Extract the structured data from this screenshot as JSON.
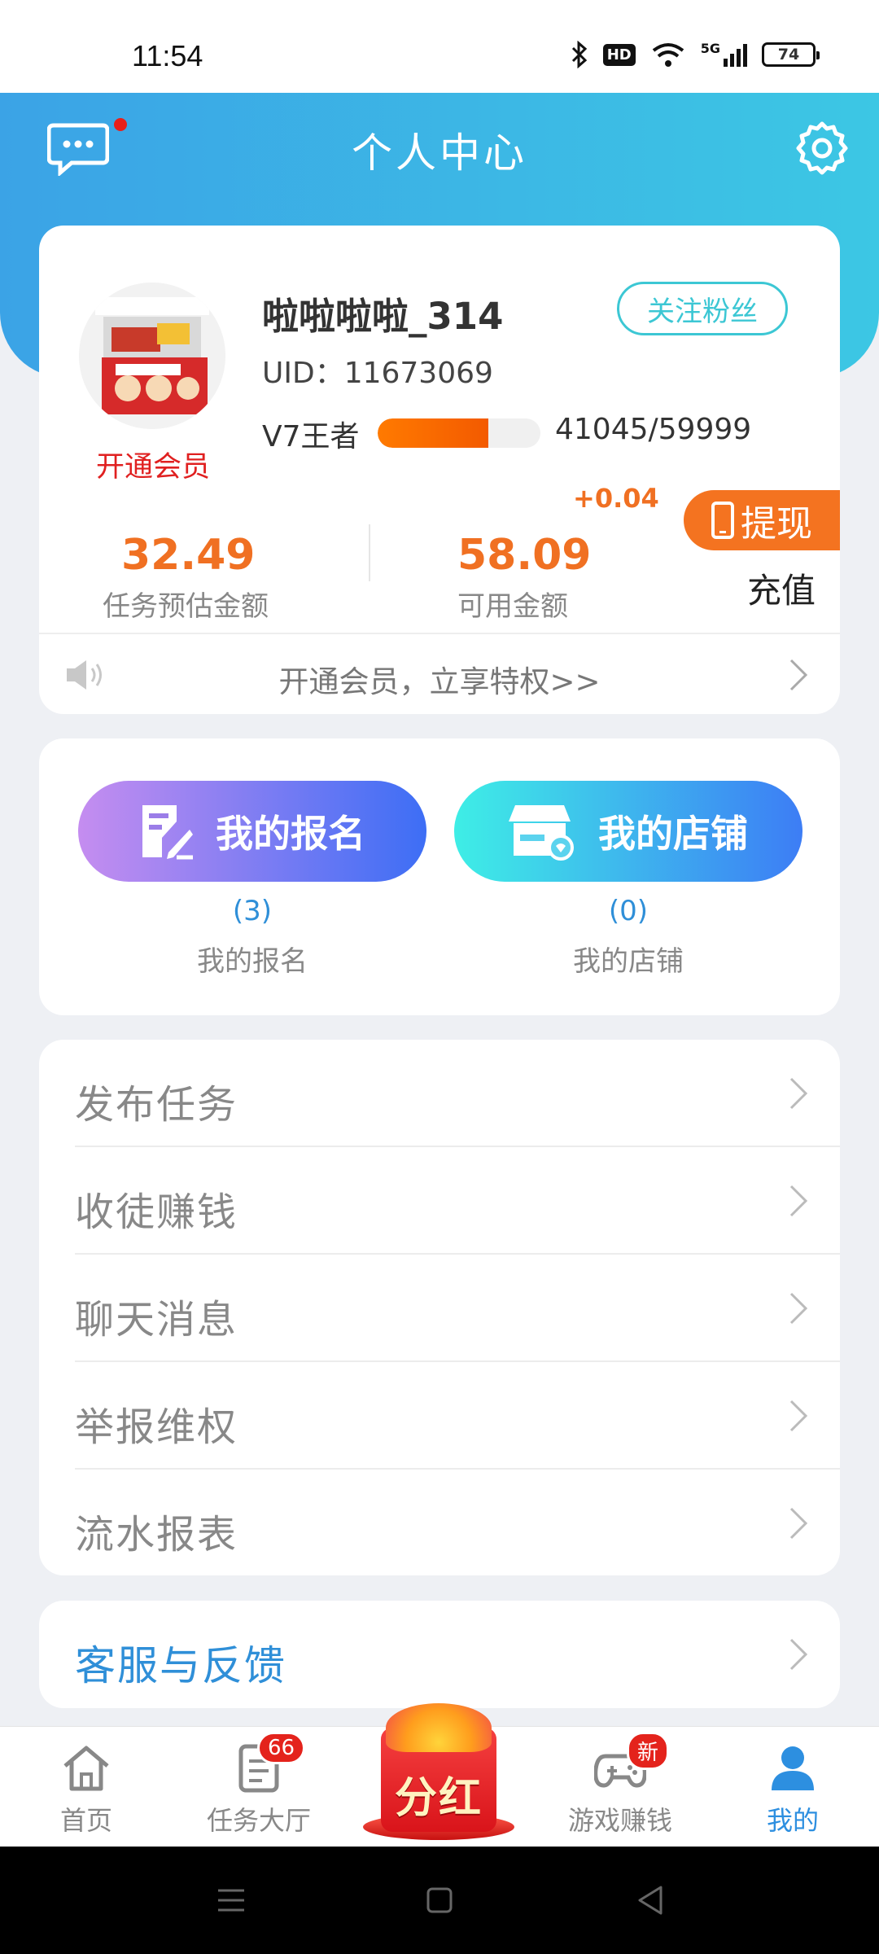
{
  "status_bar": {
    "time": "11:54",
    "battery": "74",
    "hd": "HD",
    "network": "5G"
  },
  "header": {
    "title": "个人中心"
  },
  "profile": {
    "username": "啦啦啦啦_314",
    "follow_label": "关注粉丝",
    "uid": "UID：11673069",
    "vip_link": "开通会员",
    "level": "V7王者",
    "level_progress": "41045/59999",
    "level_fraction": 0.68,
    "estimated_amount": "32.49",
    "estimated_label": "任务预估金额",
    "available_amount": "58.09",
    "available_label": "可用金额",
    "available_delta": "+0.04",
    "withdraw_label": "提现",
    "recharge_label": "充值",
    "notice": "开通会员，立享特权>>"
  },
  "shortcuts": {
    "signup": {
      "button": "我的报名",
      "count": "(3)",
      "label": "我的报名"
    },
    "store": {
      "button": "我的店铺",
      "count": "(0)",
      "label": "我的店铺"
    }
  },
  "menu": {
    "items": [
      {
        "label": "发布任务"
      },
      {
        "label": "收徒赚钱"
      },
      {
        "label": "聊天消息"
      },
      {
        "label": "举报维权"
      },
      {
        "label": "流水报表"
      }
    ],
    "feedback": "客服与反馈"
  },
  "bottom_nav": {
    "home": "首页",
    "tasks": "任务大厅",
    "tasks_badge": "66",
    "fenhong": "分红",
    "games": "游戏赚钱",
    "games_badge": "新",
    "mine": "我的"
  },
  "colors": {
    "accent": "#2d8fe0",
    "orange": "#f07022",
    "header_start": "#3ba3e6",
    "header_end": "#3cc7e4"
  }
}
